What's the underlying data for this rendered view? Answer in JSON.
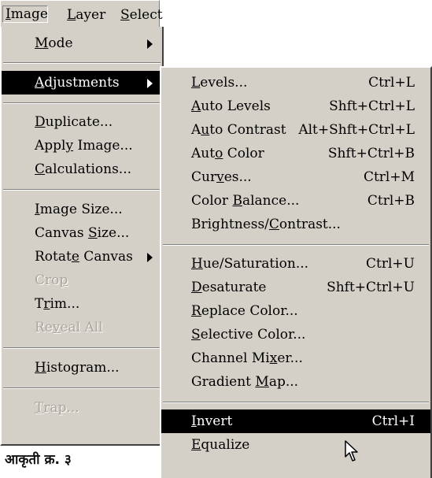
{
  "menubar": {
    "image": {
      "underline": "I",
      "rest": "mage"
    },
    "layer": {
      "underline": "L",
      "rest": "ayer"
    },
    "select": {
      "underline": "S",
      "rest": "elect"
    }
  },
  "image_menu": {
    "mode": {
      "underline": "M",
      "rest": "ode"
    },
    "adjustments": {
      "underline": "A",
      "rest": "djustments"
    },
    "duplicate": {
      "underline": "D",
      "rest": "uplicate..."
    },
    "apply_image": {
      "before": "Apply",
      "underline": "",
      "rest": " Image...",
      "pre": "Appl",
      "u": "y",
      "post": " Image..."
    },
    "calculations": {
      "underline": "C",
      "rest": "alculations..."
    },
    "image_size": {
      "underline": "I",
      "rest": "mage Size..."
    },
    "canvas_size": {
      "pre": "Canvas ",
      "u": "S",
      "post": "ize..."
    },
    "rotate_canvas": {
      "pre": "Rotat",
      "u": "e",
      "post": " Canvas"
    },
    "crop": {
      "pre": "Cro",
      "u": "p",
      "post": ""
    },
    "trim": {
      "pre": "T",
      "u": "r",
      "post": "im..."
    },
    "reveal_all": {
      "pre": "Re",
      "u": "v",
      "post": "eal All"
    },
    "histogram": {
      "underline": "H",
      "rest": "istogram..."
    },
    "trap": {
      "pre": "",
      "u": "T",
      "post": "rap..."
    }
  },
  "adjustments_menu": {
    "levels": {
      "u": "L",
      "post": "evels...",
      "shortcut": "Ctrl+L"
    },
    "auto_levels": {
      "u": "A",
      "post": "uto Levels",
      "shortcut": "Shft+Ctrl+L"
    },
    "auto_contrast": {
      "pre": "A",
      "u": "u",
      "post": "to Contrast",
      "shortcut": "Alt+Shft+Ctrl+L"
    },
    "auto_color": {
      "pre": "Aut",
      "u": "o",
      "post": " Color",
      "shortcut": "Shft+Ctrl+B"
    },
    "curves": {
      "pre": "Cur",
      "u": "v",
      "post": "es...",
      "shortcut": "Ctrl+M"
    },
    "color_balance": {
      "pre": "Color ",
      "u": "B",
      "post": "alance...",
      "shortcut": "Ctrl+B"
    },
    "brightness_contrast": {
      "pre": "Brightness/",
      "u": "C",
      "post": "ontrast..."
    },
    "hue_saturation": {
      "u": "H",
      "post": "ue/Saturation...",
      "shortcut": "Ctrl+U"
    },
    "desaturate": {
      "u": "D",
      "post": "esaturate",
      "shortcut": "Shft+Ctrl+U"
    },
    "replace_color": {
      "u": "R",
      "post": "eplace Color..."
    },
    "selective_color": {
      "u": "S",
      "post": "elective Color..."
    },
    "channel_mixer": {
      "pre": "Channel Mi",
      "u": "x",
      "post": "er..."
    },
    "gradient_map": {
      "pre": "Gradient ",
      "u": "M",
      "post": "ap..."
    },
    "invert": {
      "u": "I",
      "post": "nvert",
      "shortcut": "Ctrl+I"
    },
    "equalize": {
      "u": "E",
      "post": "qualize"
    }
  },
  "caption": "आकृती क्र. ३",
  "colors": {
    "menu_bg": "#d4d0c8",
    "highlight": "#000000",
    "disabled": "#a9a59c"
  },
  "icons": {
    "submenu_arrow": "triangle-right-icon",
    "cursor": "mouse-pointer-icon"
  }
}
